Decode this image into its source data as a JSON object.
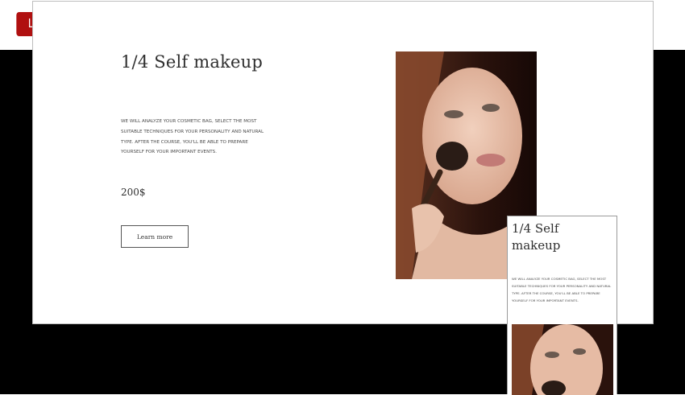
{
  "live_badge": {
    "label": "LIVE",
    "color": "#b01010"
  },
  "desktop": {
    "title": "1/4 Self makeup",
    "description": "We will analyze your cosmetic bag, select the most suitable techniques for your personality and natural type. After the course, you'll be able to prepare yourself for your important events.",
    "price": "200$",
    "button_label": "Learn more"
  },
  "mobile": {
    "title": "1/4 Self makeup",
    "description": "We will analyze your cosmetic bag, select the most suitable techniques for your personality and natural type. After the course, you'll be able to prepare yourself for your important events."
  },
  "colors": {
    "background_band": "#000000",
    "card": "#ffffff",
    "text": "#2e2e2e"
  },
  "images": {
    "photo_subject": "woman-applying-makeup-brush-photo"
  }
}
